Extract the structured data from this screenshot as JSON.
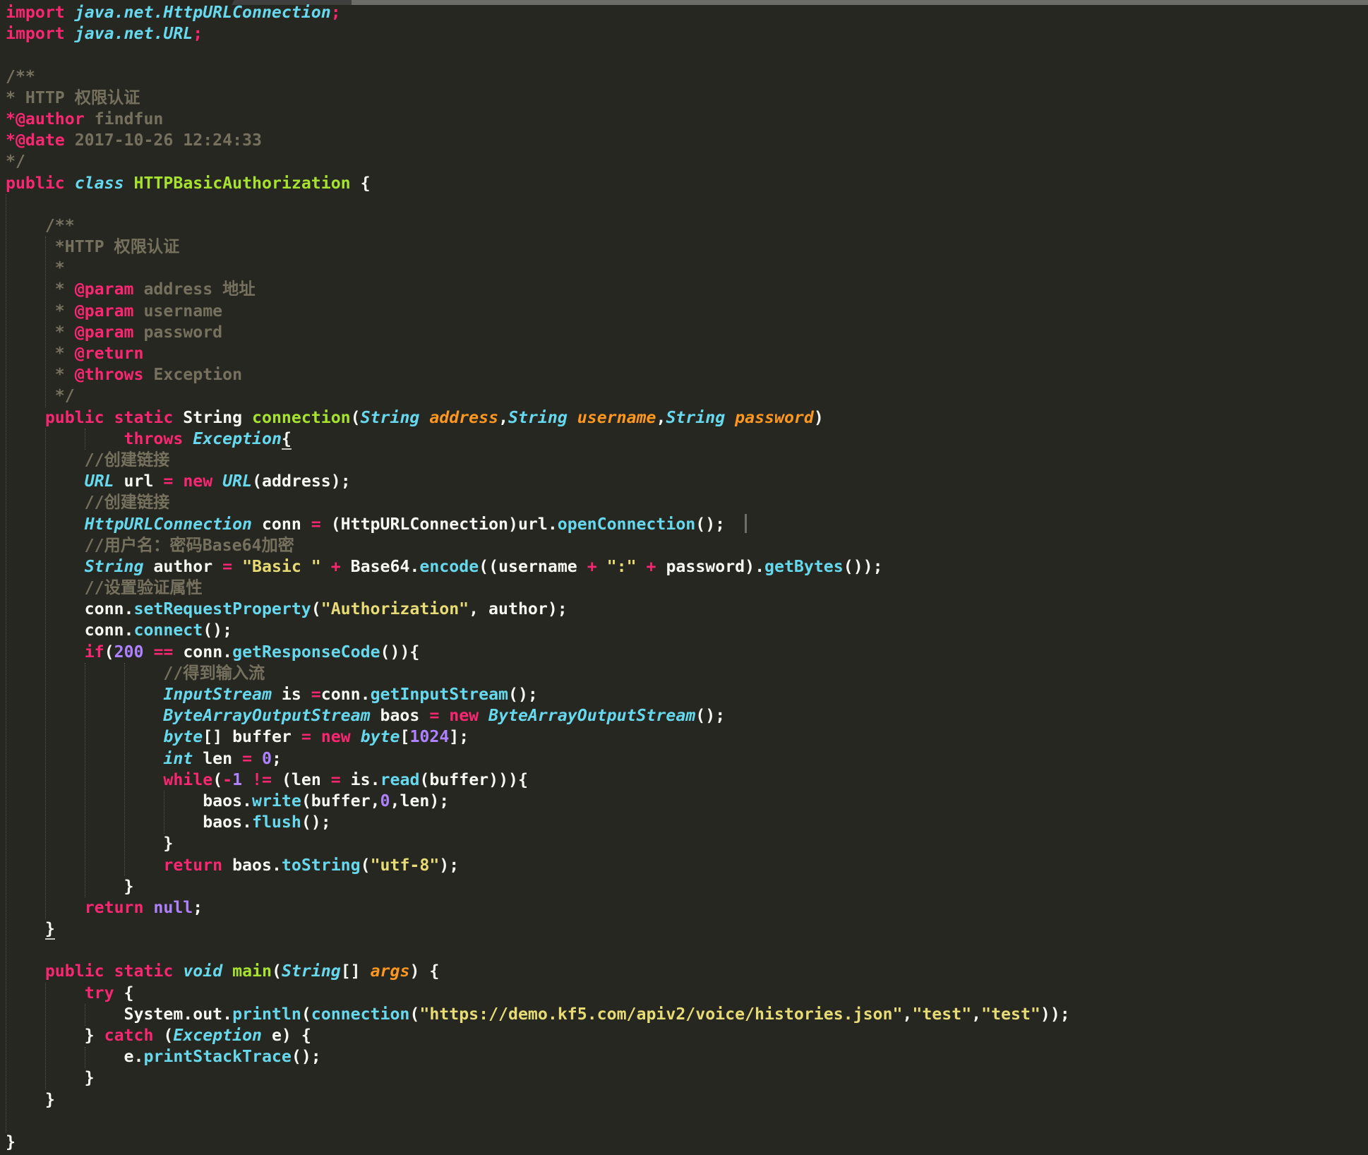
{
  "editor": {
    "palette": {
      "bg": "#272721",
      "k": "#f92672",
      "t": "#66d9ef",
      "m": "#66d9ef",
      "g": "#a6e22e",
      "s": "#e6db74",
      "n": "#ae81ff",
      "c": "#75715e",
      "p": "#fd971f",
      "w": "#f8f8f2",
      "guide": "#54544b",
      "cursor": "#6f6f69",
      "strip_light": "#6c6c68",
      "strip_dark": "#3e3f3e"
    },
    "cursor_line": 25,
    "lines": [
      [
        [
          "k",
          "import"
        ],
        [
          "w",
          " "
        ],
        [
          "t",
          "java.net.HttpURLConnection"
        ],
        [
          "k",
          ";"
        ]
      ],
      [
        [
          "k",
          "import"
        ],
        [
          "w",
          " "
        ],
        [
          "t",
          "java.net.URL"
        ],
        [
          "k",
          ";"
        ]
      ],
      [],
      [
        [
          "c",
          "/**"
        ]
      ],
      [
        [
          "c",
          "* HTTP 权限认证"
        ]
      ],
      [
        [
          "k",
          "*@author"
        ],
        [
          "c",
          " findfun"
        ]
      ],
      [
        [
          "k",
          "*@date"
        ],
        [
          "c",
          " 2017-10-26 12:24:33"
        ]
      ],
      [
        [
          "c",
          "*/"
        ]
      ],
      [
        [
          "k",
          "public"
        ],
        [
          "w",
          " "
        ],
        [
          "t",
          "class"
        ],
        [
          "w",
          " "
        ],
        [
          "g",
          "HTTPBasicAuthorization"
        ],
        [
          "w",
          " {"
        ]
      ],
      [],
      [
        [
          "c",
          "    /**"
        ]
      ],
      [
        [
          "c",
          "     *HTTP 权限认证"
        ]
      ],
      [
        [
          "c",
          "     *"
        ]
      ],
      [
        [
          "c",
          "     * "
        ],
        [
          "k",
          "@param"
        ],
        [
          "c",
          " address 地址"
        ]
      ],
      [
        [
          "c",
          "     * "
        ],
        [
          "k",
          "@param"
        ],
        [
          "c",
          " username"
        ]
      ],
      [
        [
          "c",
          "     * "
        ],
        [
          "k",
          "@param"
        ],
        [
          "c",
          " password"
        ]
      ],
      [
        [
          "c",
          "     * "
        ],
        [
          "k",
          "@return"
        ]
      ],
      [
        [
          "c",
          "     * "
        ],
        [
          "k",
          "@throws"
        ],
        [
          "c",
          " Exception"
        ]
      ],
      [
        [
          "c",
          "     */"
        ]
      ],
      [
        [
          "w",
          "    "
        ],
        [
          "k",
          "public"
        ],
        [
          "w",
          " "
        ],
        [
          "k",
          "static"
        ],
        [
          "w",
          " String "
        ],
        [
          "g",
          "connection"
        ],
        [
          "w",
          "("
        ],
        [
          "t",
          "String"
        ],
        [
          "w",
          " "
        ],
        [
          "p",
          "address"
        ],
        [
          "w",
          ","
        ],
        [
          "t",
          "String"
        ],
        [
          "w",
          " "
        ],
        [
          "p",
          "username"
        ],
        [
          "w",
          ","
        ],
        [
          "t",
          "String"
        ],
        [
          "w",
          " "
        ],
        [
          "p",
          "password"
        ],
        [
          "w",
          ")"
        ]
      ],
      [
        [
          "w",
          "            "
        ],
        [
          "k",
          "throws"
        ],
        [
          "w",
          " "
        ],
        [
          "t",
          "Exception"
        ],
        [
          "w u",
          "{"
        ]
      ],
      [
        [
          "c",
          "        //创建链接"
        ]
      ],
      [
        [
          "w",
          "        "
        ],
        [
          "t",
          "URL"
        ],
        [
          "w",
          " url "
        ],
        [
          "k",
          "="
        ],
        [
          "w",
          " "
        ],
        [
          "k",
          "new"
        ],
        [
          "w",
          " "
        ],
        [
          "t",
          "URL"
        ],
        [
          "w",
          "(address);"
        ]
      ],
      [
        [
          "c",
          "        //创建链接"
        ]
      ],
      [
        [
          "w",
          "        "
        ],
        [
          "t",
          "HttpURLConnection"
        ],
        [
          "w",
          " conn "
        ],
        [
          "k",
          "="
        ],
        [
          "w",
          " (HttpURLConnection)url."
        ],
        [
          "m",
          "openConnection"
        ],
        [
          "w",
          "();  "
        ]
      ],
      [
        [
          "c",
          "        //用户名：密码Base64加密"
        ]
      ],
      [
        [
          "w",
          "        "
        ],
        [
          "t",
          "String"
        ],
        [
          "w",
          " author "
        ],
        [
          "k",
          "="
        ],
        [
          "w",
          " "
        ],
        [
          "s",
          "\"Basic \""
        ],
        [
          "w",
          " "
        ],
        [
          "k",
          "+"
        ],
        [
          "w",
          " Base64."
        ],
        [
          "m",
          "encode"
        ],
        [
          "w",
          "((username "
        ],
        [
          "k",
          "+"
        ],
        [
          "w",
          " "
        ],
        [
          "s",
          "\":\""
        ],
        [
          "w",
          " "
        ],
        [
          "k",
          "+"
        ],
        [
          "w",
          " password)."
        ],
        [
          "m",
          "getBytes"
        ],
        [
          "w",
          "());"
        ]
      ],
      [
        [
          "c",
          "        //设置验证属性"
        ]
      ],
      [
        [
          "w",
          "        conn."
        ],
        [
          "m",
          "setRequestProperty"
        ],
        [
          "w",
          "("
        ],
        [
          "s",
          "\"Authorization\""
        ],
        [
          "w",
          ", author);"
        ]
      ],
      [
        [
          "w",
          "        conn."
        ],
        [
          "m",
          "connect"
        ],
        [
          "w",
          "();"
        ]
      ],
      [
        [
          "w",
          "        "
        ],
        [
          "k",
          "if"
        ],
        [
          "w",
          "("
        ],
        [
          "n",
          "200"
        ],
        [
          "w",
          " "
        ],
        [
          "k",
          "=="
        ],
        [
          "w",
          " conn."
        ],
        [
          "m",
          "getResponseCode"
        ],
        [
          "w",
          "()){"
        ]
      ],
      [
        [
          "c",
          "                //得到输入流"
        ]
      ],
      [
        [
          "w",
          "                "
        ],
        [
          "t",
          "InputStream"
        ],
        [
          "w",
          " is "
        ],
        [
          "k",
          "="
        ],
        [
          "w",
          "conn."
        ],
        [
          "m",
          "getInputStream"
        ],
        [
          "w",
          "();"
        ]
      ],
      [
        [
          "w",
          "                "
        ],
        [
          "t",
          "ByteArrayOutputStream"
        ],
        [
          "w",
          " baos "
        ],
        [
          "k",
          "="
        ],
        [
          "w",
          " "
        ],
        [
          "k",
          "new"
        ],
        [
          "w",
          " "
        ],
        [
          "t",
          "ByteArrayOutputStream"
        ],
        [
          "w",
          "();"
        ]
      ],
      [
        [
          "w",
          "                "
        ],
        [
          "t",
          "byte"
        ],
        [
          "w",
          "[] buffer "
        ],
        [
          "k",
          "="
        ],
        [
          "w",
          " "
        ],
        [
          "k",
          "new"
        ],
        [
          "w",
          " "
        ],
        [
          "t",
          "byte"
        ],
        [
          "w",
          "["
        ],
        [
          "n",
          "1024"
        ],
        [
          "w",
          "];"
        ]
      ],
      [
        [
          "w",
          "                "
        ],
        [
          "t",
          "int"
        ],
        [
          "w",
          " len "
        ],
        [
          "k",
          "="
        ],
        [
          "w",
          " "
        ],
        [
          "n",
          "0"
        ],
        [
          "w",
          ";"
        ]
      ],
      [
        [
          "w",
          "                "
        ],
        [
          "k",
          "while"
        ],
        [
          "w",
          "("
        ],
        [
          "k",
          "-"
        ],
        [
          "n",
          "1"
        ],
        [
          "w",
          " "
        ],
        [
          "k",
          "!="
        ],
        [
          "w",
          " (len "
        ],
        [
          "k",
          "="
        ],
        [
          "w",
          " is."
        ],
        [
          "m",
          "read"
        ],
        [
          "w",
          "(buffer))){"
        ]
      ],
      [
        [
          "w",
          "                    baos."
        ],
        [
          "m",
          "write"
        ],
        [
          "w",
          "(buffer,"
        ],
        [
          "n",
          "0"
        ],
        [
          "w",
          ",len);"
        ]
      ],
      [
        [
          "w",
          "                    baos."
        ],
        [
          "m",
          "flush"
        ],
        [
          "w",
          "();"
        ]
      ],
      [
        [
          "w",
          "                }"
        ]
      ],
      [
        [
          "w",
          "                "
        ],
        [
          "k",
          "return"
        ],
        [
          "w",
          " baos."
        ],
        [
          "m",
          "toString"
        ],
        [
          "w",
          "("
        ],
        [
          "s",
          "\"utf-8\""
        ],
        [
          "w",
          ");"
        ]
      ],
      [
        [
          "w",
          "            }"
        ]
      ],
      [
        [
          "w",
          "        "
        ],
        [
          "k",
          "return"
        ],
        [
          "w",
          " "
        ],
        [
          "n",
          "null"
        ],
        [
          "w",
          ";"
        ]
      ],
      [
        [
          "w",
          "    "
        ],
        [
          "w u",
          "}"
        ]
      ],
      [],
      [
        [
          "w",
          "    "
        ],
        [
          "k",
          "public"
        ],
        [
          "w",
          " "
        ],
        [
          "k",
          "static"
        ],
        [
          "w",
          " "
        ],
        [
          "t",
          "void"
        ],
        [
          "w",
          " "
        ],
        [
          "g",
          "main"
        ],
        [
          "w",
          "("
        ],
        [
          "t",
          "String"
        ],
        [
          "w",
          "[] "
        ],
        [
          "p",
          "args"
        ],
        [
          "w",
          ") {"
        ]
      ],
      [
        [
          "w",
          "        "
        ],
        [
          "k",
          "try"
        ],
        [
          "w",
          " {"
        ]
      ],
      [
        [
          "w",
          "            System.out."
        ],
        [
          "m",
          "println"
        ],
        [
          "w",
          "("
        ],
        [
          "m",
          "connection"
        ],
        [
          "w",
          "("
        ],
        [
          "s",
          "\"https://demo.kf5.com/apiv2/voice/histories.json\""
        ],
        [
          "w",
          ","
        ],
        [
          "s",
          "\"test\""
        ],
        [
          "w",
          ","
        ],
        [
          "s",
          "\"test\""
        ],
        [
          "w",
          "));"
        ]
      ],
      [
        [
          "w",
          "        } "
        ],
        [
          "k",
          "catch"
        ],
        [
          "w",
          " ("
        ],
        [
          "t",
          "Exception"
        ],
        [
          "w",
          " e) {"
        ]
      ],
      [
        [
          "w",
          "            e."
        ],
        [
          "m",
          "printStackTrace"
        ],
        [
          "w",
          "();"
        ]
      ],
      [
        [
          "w",
          "        }"
        ]
      ],
      [
        [
          "w",
          "    }"
        ]
      ],
      [],
      [
        [
          "w",
          "}"
        ]
      ]
    ],
    "indent_guides": [
      {
        "col": 0,
        "from": 10,
        "to": 53
      },
      {
        "col": 4,
        "from": 12,
        "to": 19
      },
      {
        "col": 4,
        "from": 21,
        "to": 43
      },
      {
        "col": 4,
        "from": 47,
        "to": 51
      },
      {
        "col": 8,
        "from": 21,
        "to": 21
      },
      {
        "col": 8,
        "from": 32,
        "to": 42
      },
      {
        "col": 8,
        "from": 48,
        "to": 48
      },
      {
        "col": 8,
        "from": 50,
        "to": 50
      },
      {
        "col": 12,
        "from": 32,
        "to": 41
      },
      {
        "col": 16,
        "from": 38,
        "to": 39
      }
    ]
  }
}
